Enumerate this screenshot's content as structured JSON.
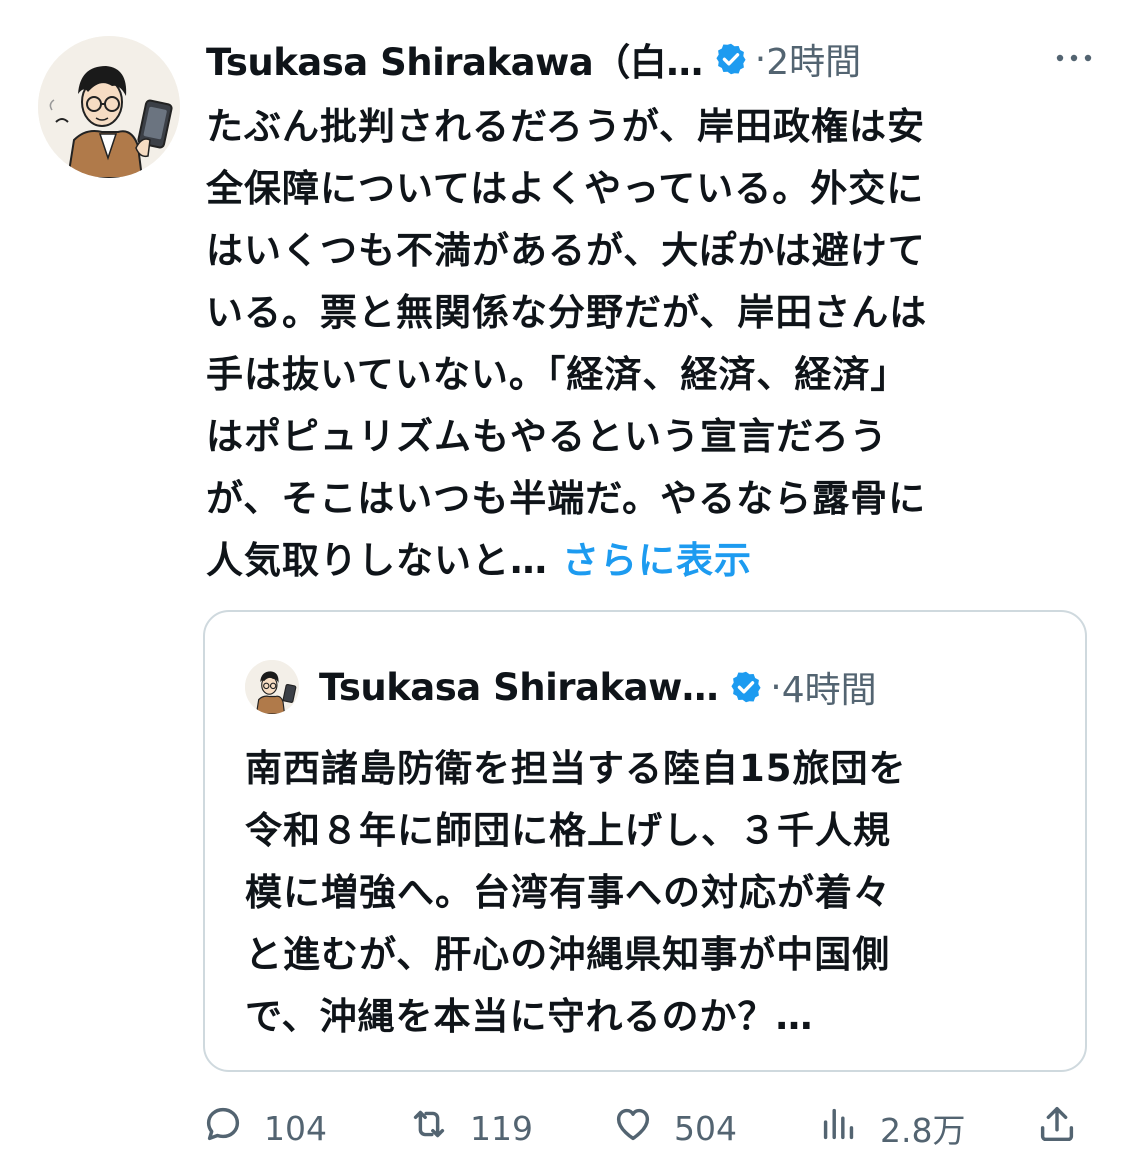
{
  "tweet": {
    "author_name": "Tsukasa Shirakawa（白…",
    "dot": "·",
    "time": "2時間",
    "text_lines": [
      "たぶん批判されるだろうが、岸田政権は安",
      "全保障についてはよくやっている。外交に",
      "はいくつも不満があるが、大ぽかは避けて",
      "いる。票と無関係な分野だが、岸田さんは",
      "手は抜いていない。「経済、経済、経済」",
      "はポピュリズムもやるという宣言だろう",
      "が、そこはいつも半端だ。やるなら露骨に",
      "人気取りしないと…"
    ],
    "show_more": "さらに表示"
  },
  "quote": {
    "author_name": "Tsukasa Shirakaw…",
    "dot": "·",
    "time": "4時間",
    "text_lines": [
      "南西諸島防衛を担当する陸自15旅団を",
      "令和８年に師団に格上げし、３千人規",
      "模に増強へ。台湾有事への対応が着々",
      "と進むが、肝心の沖縄県知事が中国側",
      "で、沖縄を本当に守れるのか？…"
    ]
  },
  "actions": {
    "replies": "104",
    "retweets": "119",
    "likes": "504",
    "views": "2.8万"
  },
  "colors": {
    "accent": "#1d9bf0",
    "text": "#0f1419",
    "muted": "#536471",
    "border": "#cfd9de"
  },
  "icons": [
    "verified-badge-icon",
    "more-icon",
    "reply-icon",
    "retweet-icon",
    "like-icon",
    "views-icon",
    "share-icon"
  ]
}
